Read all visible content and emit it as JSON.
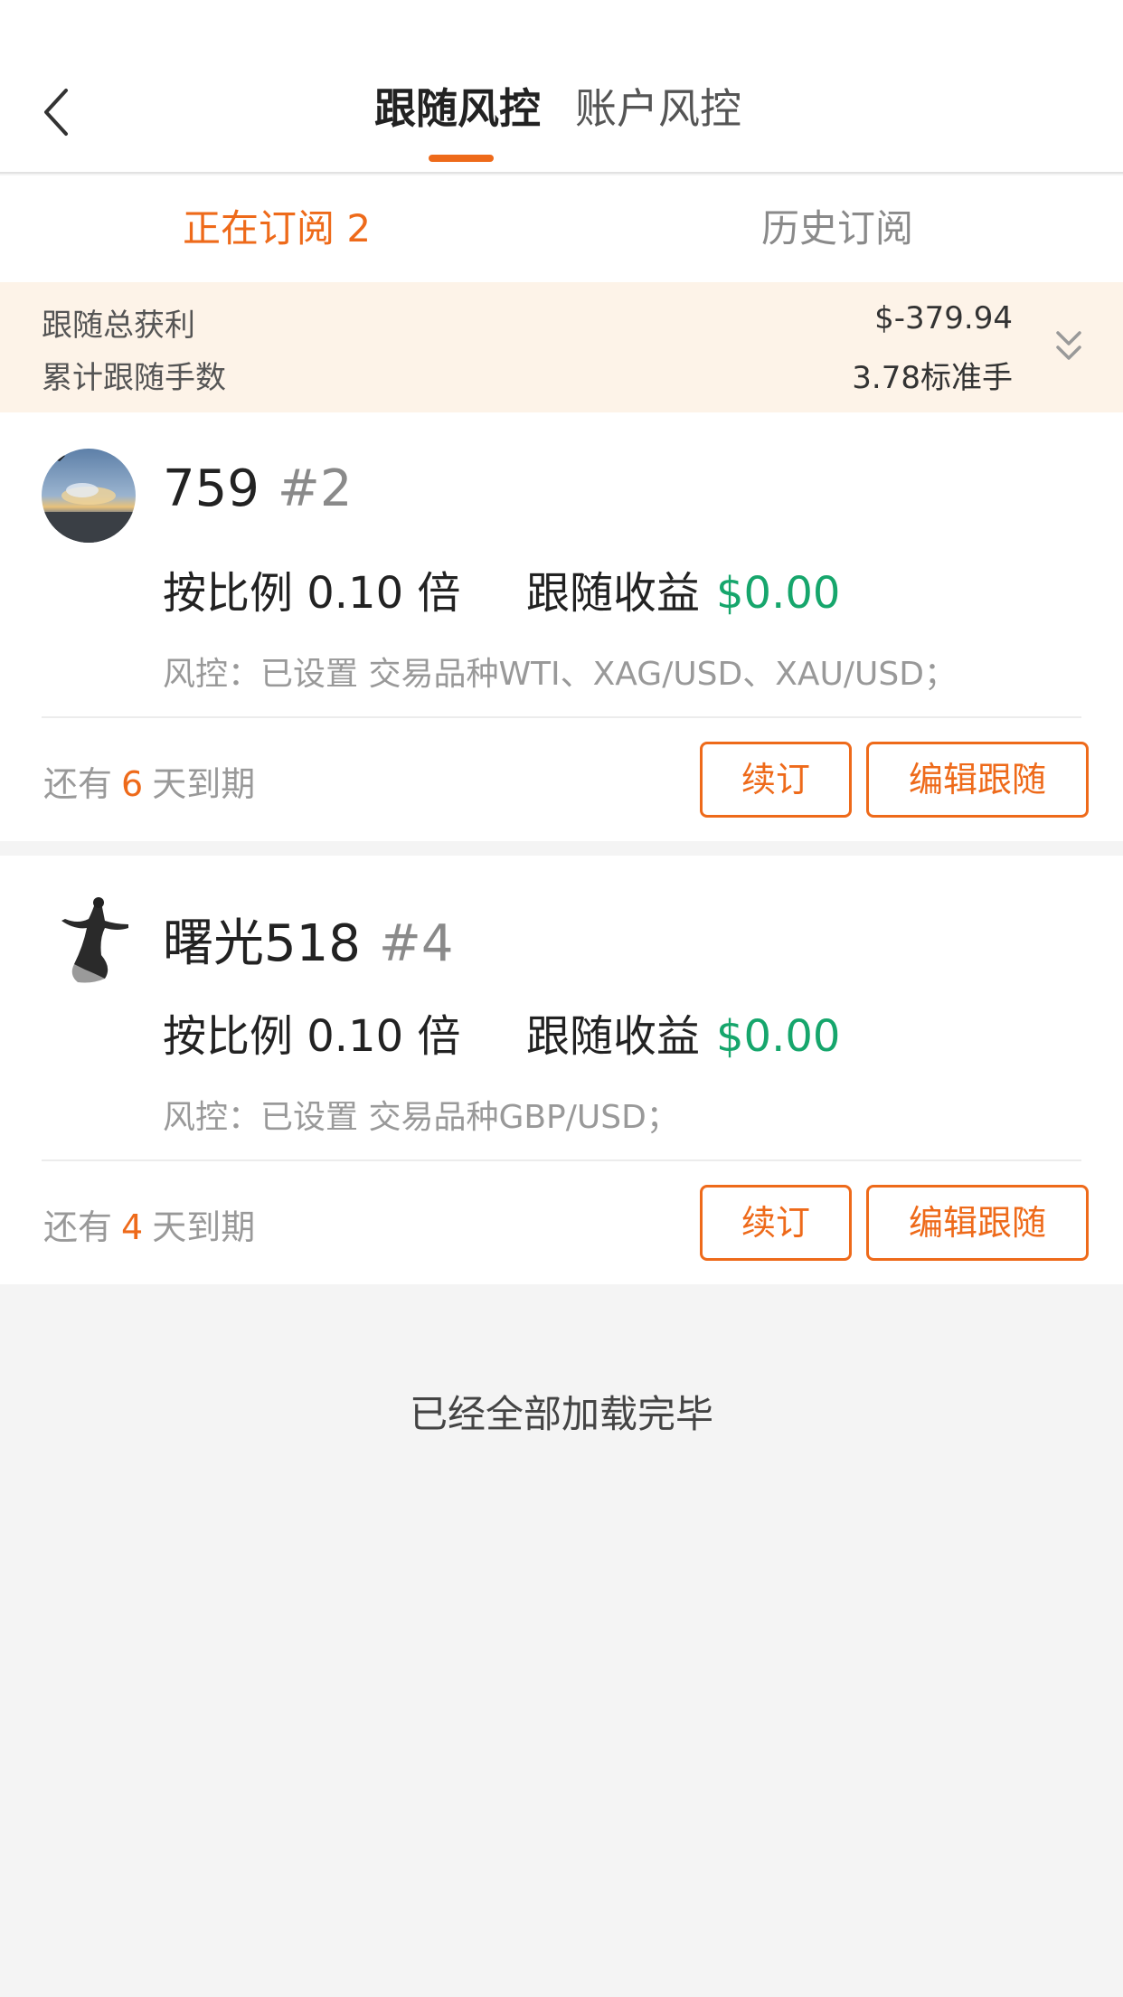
{
  "colors": {
    "accent": "#ee6a1a",
    "profit_green": "#16a66c",
    "summary_bg": "#fdf3e8",
    "page_bg": "#f4f4f4"
  },
  "header": {
    "back_icon": "chevron-left-icon",
    "tabs": [
      {
        "label": "跟随风控",
        "active": true
      },
      {
        "label": "账户风控",
        "active": false
      }
    ]
  },
  "sub_tabs": [
    {
      "label": "正在订阅 2",
      "active": true
    },
    {
      "label": "历史订阅",
      "active": false
    }
  ],
  "summary": {
    "total_profit_label": "跟随总获利",
    "total_profit_value": "$-379.94",
    "total_lots_label": "累计跟随手数",
    "total_lots_value": "3.78标准手",
    "expand_icon": "double-chevron-down-icon"
  },
  "subscriptions": [
    {
      "name": "759",
      "rank": "#2",
      "ratio": "按比例 0.10 倍",
      "profit_label": "跟随收益",
      "profit_value": "$0.00",
      "risk": "风控：已设置 交易品种WTI、XAG/USD、XAU/USD；",
      "expire_prefix": "还有",
      "expire_days": "6",
      "expire_suffix": "天到期",
      "renew_label": "续订",
      "edit_label": "编辑跟随"
    },
    {
      "name": "曙光518",
      "rank": "#4",
      "ratio": "按比例 0.10 倍",
      "profit_label": "跟随收益",
      "profit_value": "$0.00",
      "risk": "风控：已设置 交易品种GBP/USD；",
      "expire_prefix": "还有",
      "expire_days": "4",
      "expire_suffix": "天到期",
      "renew_label": "续订",
      "edit_label": "编辑跟随"
    }
  ],
  "footer": {
    "all_loaded": "已经全部加载完毕"
  }
}
